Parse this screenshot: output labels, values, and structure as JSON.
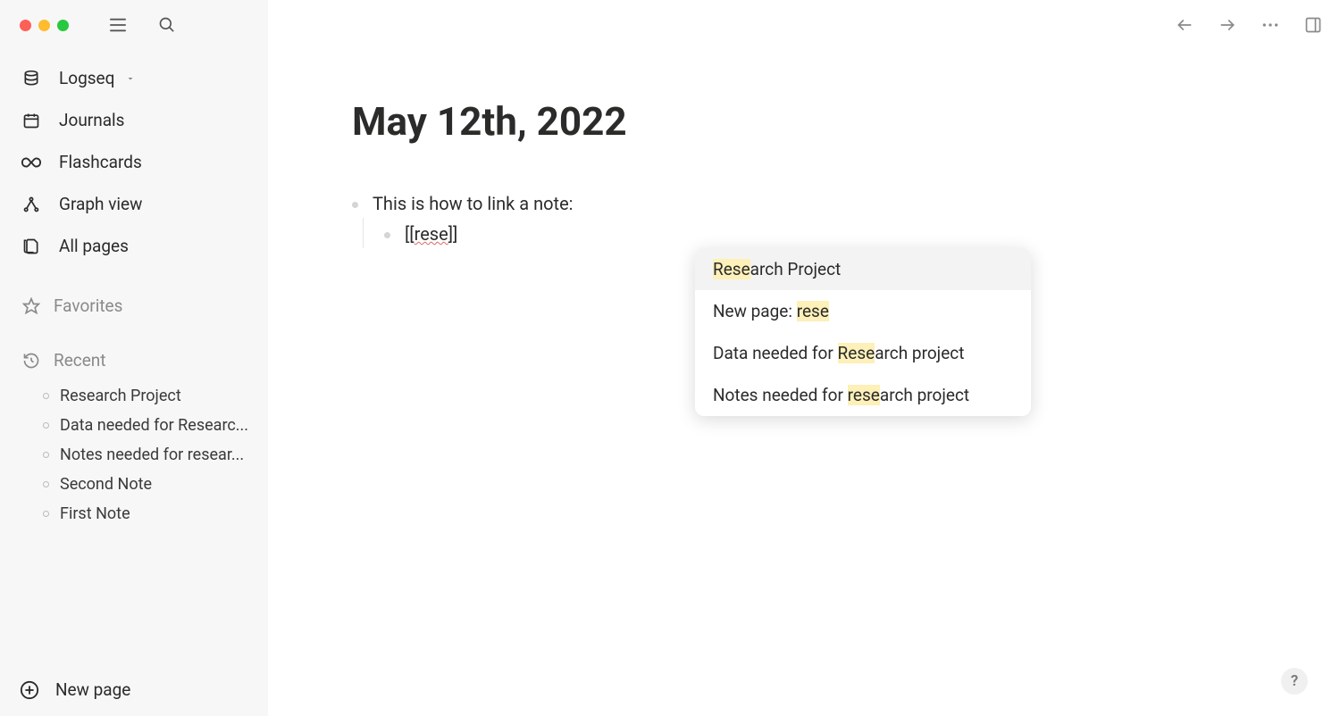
{
  "workspace": {
    "name": "Logseq"
  },
  "nav": {
    "journals": "Journals",
    "flashcards": "Flashcards",
    "graph": "Graph view",
    "allpages": "All pages"
  },
  "sections": {
    "favorites": "Favorites",
    "recent": "Recent"
  },
  "recent": [
    "Research Project",
    "Data needed for Researc...",
    "Notes needed for resear...",
    "Second Note",
    "First Note"
  ],
  "footer": {
    "newpage": "New page"
  },
  "page": {
    "title": "May 12th, 2022",
    "block1": "This is how to link a note:",
    "link_open": "[[",
    "link_query": "rese",
    "link_close": "]]"
  },
  "autocomplete": {
    "items": [
      {
        "prefix": "",
        "match": "Rese",
        "suffix": "arch Project"
      },
      {
        "prefix": "New page: ",
        "match": "rese",
        "suffix": ""
      },
      {
        "prefix": "Data needed for ",
        "match": "Rese",
        "suffix": "arch project"
      },
      {
        "prefix": "Notes needed for ",
        "match": "rese",
        "suffix": "arch project"
      }
    ]
  },
  "help": "?"
}
